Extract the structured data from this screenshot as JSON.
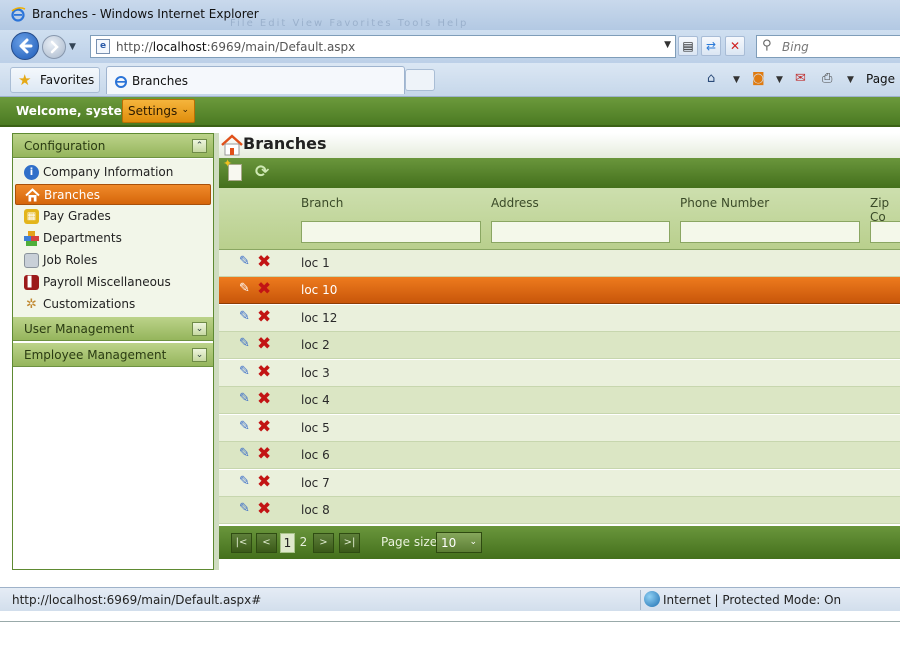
{
  "window": {
    "title": "Branches - Windows Internet Explorer",
    "ghost_menu": "File  Edit  View  Favorites  Tools  Help"
  },
  "addressbar": {
    "url_prefix": "http://",
    "url_host": "localhost",
    "url_rest": ":6969/main/Default.aspx",
    "search_placeholder": "Bing"
  },
  "favbar": {
    "favorites_label": "Favorites",
    "tab_label": "Branches",
    "page_label": "Page"
  },
  "app": {
    "welcome": "Welcome, system",
    "settings_label": "Settings"
  },
  "sidebar": {
    "sections": [
      {
        "label": "Configuration",
        "toggle": "^"
      },
      {
        "label": "User Management",
        "toggle": "v"
      },
      {
        "label": "Employee Management",
        "toggle": "v"
      }
    ],
    "items": [
      {
        "label": "Company Information",
        "icon": "info-icon",
        "color": "#2f6fc9"
      },
      {
        "label": "Branches",
        "icon": "home-icon",
        "color": "#e05515",
        "selected": true
      },
      {
        "label": "Pay Grades",
        "icon": "gift-icon",
        "color": "#e3b51b"
      },
      {
        "label": "Departments",
        "icon": "blocks-icon",
        "color": "#4a86d8"
      },
      {
        "label": "Job Roles",
        "icon": "card-icon",
        "color": "#9aa3ad"
      },
      {
        "label": "Payroll Miscellaneous",
        "icon": "book-icon",
        "color": "#9c1a1a"
      },
      {
        "label": "Customizations",
        "icon": "tools-icon",
        "color": "#c08830"
      }
    ]
  },
  "main": {
    "title": "Branches",
    "columns": [
      "Branch",
      "Address",
      "Phone Number",
      "Zip Co"
    ],
    "rows": [
      "loc 1",
      "loc 10",
      "loc 12",
      "loc 2",
      "loc 3",
      "loc 4",
      "loc 5",
      "loc 6",
      "loc 7",
      "loc 8"
    ],
    "selected_row": "loc 10",
    "pager": {
      "first": "|<",
      "prev": "<",
      "pages": [
        "1",
        "2"
      ],
      "current_page": "1",
      "next": ">",
      "last": ">|",
      "page_size_label": "Page size:",
      "page_size": "10"
    }
  },
  "statusbar": {
    "url": "http://localhost:6969/main/Default.aspx#",
    "zone": "Internet | Protected Mode: On"
  },
  "colors": {
    "accent_green": "#4b7a22",
    "selection_orange": "#e0700f",
    "settings_orange": "#f0a52a"
  }
}
